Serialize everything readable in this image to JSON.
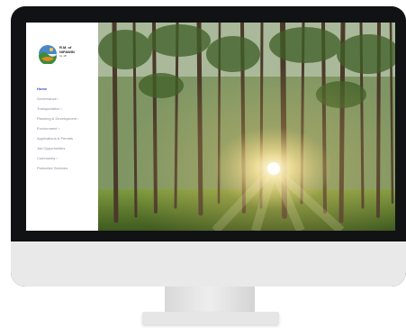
{
  "logo": {
    "title": "R.M. of",
    "name": "NIPAWIN",
    "subtitle": "No. 487"
  },
  "nav": {
    "items": [
      {
        "label": "Home",
        "active": true
      },
      {
        "label": "Governance ›",
        "active": false
      },
      {
        "label": "Transportation ›",
        "active": false
      },
      {
        "label": "Planning & Development ›",
        "active": false
      },
      {
        "label": "Environment ›",
        "active": false
      },
      {
        "label": "Applications & Permits",
        "active": false
      },
      {
        "label": "Job Opportunities",
        "active": false
      },
      {
        "label": "Community ›",
        "active": false
      },
      {
        "label": "Protective Services",
        "active": false
      }
    ]
  },
  "colors": {
    "nav_active": "#3b4ab0",
    "nav_inactive": "#8a8a9a",
    "bezel": "#111214",
    "sunlight": "#fff4c8"
  }
}
